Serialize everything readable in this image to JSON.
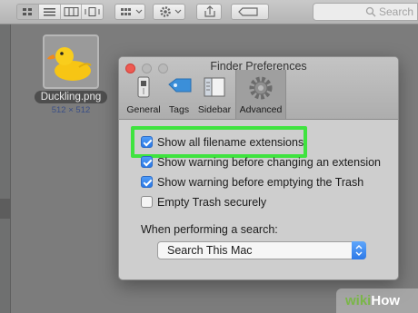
{
  "finder": {
    "search_placeholder": "Search",
    "file": {
      "name": "Duckling.png",
      "size": "512 × 512"
    }
  },
  "preferences": {
    "title": "Finder Preferences",
    "tabs": [
      {
        "label": "General",
        "icon": "general-switch-icon"
      },
      {
        "label": "Tags",
        "icon": "tag-icon"
      },
      {
        "label": "Sidebar",
        "icon": "sidebar-icon"
      },
      {
        "label": "Advanced",
        "icon": "gear-icon",
        "selected": true
      }
    ],
    "options": [
      {
        "label": "Show all filename extensions",
        "checked": true
      },
      {
        "label": "Show warning before changing an extension",
        "checked": true
      },
      {
        "label": "Show warning before emptying the Trash",
        "checked": true
      },
      {
        "label": "Empty Trash securely",
        "checked": false
      }
    ],
    "search_label": "When performing a search:",
    "search_scope": "Search This Mac"
  },
  "watermark": {
    "prefix": "wiki",
    "suffix": "How"
  },
  "colors": {
    "highlight": "#3fe33f",
    "checkbox": "#2a78e6"
  }
}
